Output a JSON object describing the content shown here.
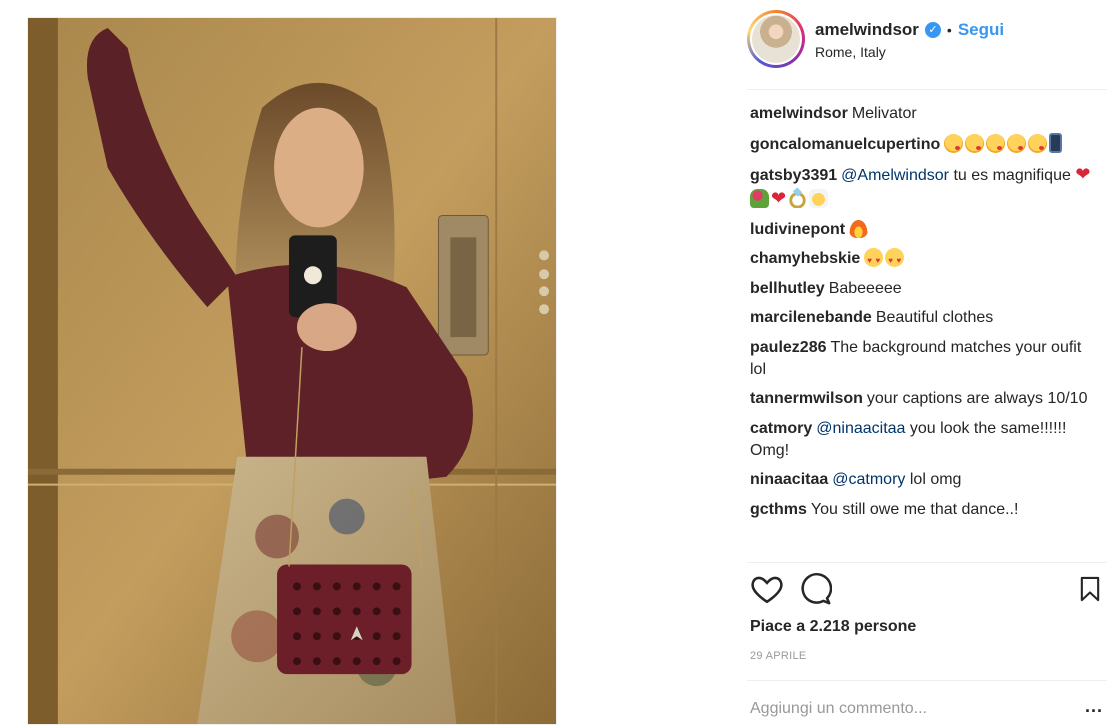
{
  "post": {
    "username": "amelwindsor",
    "verified_icon": "verified-badge-icon",
    "separator": "•",
    "follow_label": "Segui",
    "location": "Rome, Italy"
  },
  "comments": [
    {
      "user": "amelwindsor",
      "text": "Melivator",
      "emoji": []
    },
    {
      "user": "goncalomanuelcupertino",
      "text": "",
      "emoji": [
        "kiss",
        "kiss",
        "kiss",
        "kiss",
        "kiss",
        "phone"
      ]
    },
    {
      "user": "gatsby3391",
      "mention": "@Amelwindsor",
      "text": "tu es magnifique",
      "emoji": [
        "heart",
        "bouquet",
        "heart",
        "ring",
        "bride"
      ]
    },
    {
      "user": "ludivinepont",
      "text": "",
      "emoji": [
        "fire"
      ]
    },
    {
      "user": "chamyhebskie",
      "text": "",
      "emoji": [
        "hearteyes",
        "hearteyes"
      ]
    },
    {
      "user": "bellhutley",
      "text": "Babeeeee",
      "emoji": []
    },
    {
      "user": "marcilenebande",
      "text": "Beautiful clothes",
      "emoji": []
    },
    {
      "user": "paulez286",
      "text": "The background matches your oufit lol",
      "emoji": []
    },
    {
      "user": "tannermwilson",
      "text": "your captions are always 10/10",
      "emoji": []
    },
    {
      "user": "catmory",
      "mention": "@ninaacitaa",
      "text": "you look the same!!!!!! Omg!",
      "emoji": []
    },
    {
      "user": "ninaacitaa",
      "mention": "@catmory",
      "text": "lol omg",
      "emoji": []
    },
    {
      "user": "gcthms",
      "text": "You still owe me that dance..!",
      "emoji": []
    }
  ],
  "actions": {
    "like_icon": "heart-outline-icon",
    "comment_icon": "speech-bubble-icon",
    "save_icon": "bookmark-icon"
  },
  "likes_text": "Piace a 2.218 persone",
  "date_text": "29 APRILE",
  "comment_box": {
    "placeholder": "Aggiungi un commento...",
    "more_label": "..."
  },
  "colors": {
    "link_blue": "#3897f0",
    "mention_blue": "#003569",
    "text": "#262626",
    "muted": "#999999",
    "divider": "#efefef"
  }
}
